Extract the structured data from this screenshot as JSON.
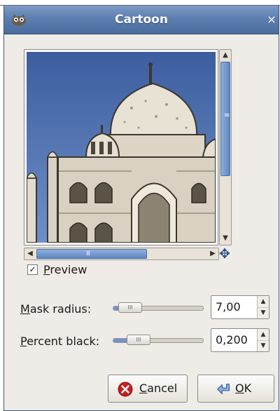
{
  "window": {
    "title": "Cartoon",
    "close_symbol": "×"
  },
  "preview": {
    "checked": true,
    "checkbox_mark": "✓",
    "label_mnemonic": "P",
    "label_rest": "review"
  },
  "mask_radius": {
    "label_mnemonic": "M",
    "label_rest": "ask radius:",
    "value": "7,00",
    "slider_fraction": 0.07
  },
  "percent_black": {
    "label_mnemonic": "P",
    "label_rest": "ercent black:",
    "value": "0,200",
    "slider_fraction": 0.2
  },
  "buttons": {
    "cancel": {
      "mnemonic": "C",
      "rest": "ancel"
    },
    "ok": {
      "mnemonic": "O",
      "rest": "K"
    }
  },
  "scroll": {
    "up": "▲",
    "down": "▼",
    "left": "◀",
    "right": "▶",
    "nav": "✥",
    "grip": "III"
  },
  "spin": {
    "up": "▲",
    "down": "▼"
  },
  "icons": [
    "gimp-icon",
    "close-icon",
    "checkbox-check-icon",
    "cancel-icon",
    "ok-arrow-icon",
    "navigate-icon"
  ],
  "colors": {
    "titlebar": "#5d7fb0",
    "accent": "#6f93c8",
    "cancel_icon": "#c81e1e"
  }
}
